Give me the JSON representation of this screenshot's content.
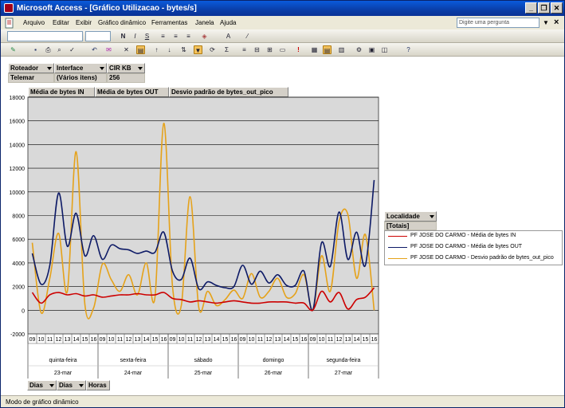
{
  "window": {
    "title": "Microsoft Access - [Gráfico Utilizacao - bytes/s]",
    "min": "_",
    "max": "❐",
    "close": "✕"
  },
  "menu": {
    "items": [
      "Arquivo",
      "Editar",
      "Exibir",
      "Gráfico dinâmico",
      "Ferramentas",
      "Janela",
      "Ajuda"
    ],
    "ask_placeholder": "Digite uma pergunta",
    "close": "×"
  },
  "filters": [
    {
      "field": "Roteador",
      "value": "Telemar"
    },
    {
      "field": "Interface",
      "value": "(Vários itens)"
    },
    {
      "field": "CIR KB",
      "value": "256"
    }
  ],
  "data_fields": [
    "Média de bytes IN",
    "Média de bytes OUT",
    "Desvio padrão de bytes_out_pico"
  ],
  "legend": {
    "title": "Localidade",
    "totals": "[Totais]",
    "entries": [
      "PF JOSE DO CARMO - Média de bytes IN",
      "PF JOSE DO CARMO - Média de bytes OUT",
      "PF JOSE DO CARMO - Desvio padrão de bytes_out_pico"
    ]
  },
  "axis_buttons": [
    "Dias",
    "Dias",
    "Horas"
  ],
  "status": "Modo de gráfico dinâmico",
  "chart_data": {
    "type": "line",
    "ylim": [
      -2000,
      18000
    ],
    "yticks": [
      18000,
      16000,
      14000,
      12000,
      10000,
      8000,
      6000,
      4000,
      2000,
      0,
      -2000
    ],
    "hours": [
      "09",
      "10",
      "11",
      "12",
      "13",
      "14",
      "15",
      "16"
    ],
    "days": [
      {
        "weekday": "quinta-feira",
        "date": "23-mar"
      },
      {
        "weekday": "sexta-feira",
        "date": "24-mar"
      },
      {
        "weekday": "sábado",
        "date": "25-mar"
      },
      {
        "weekday": "domingo",
        "date": "26-mar"
      },
      {
        "weekday": "segunda-feira",
        "date": "27-mar"
      }
    ],
    "series": [
      {
        "name": "PF JOSE DO CARMO - Média de bytes IN",
        "color": "#cc0000",
        "values": [
          1500,
          600,
          1300,
          1500,
          1300,
          1400,
          1200,
          1300,
          1100,
          1200,
          1300,
          1300,
          1400,
          1300,
          1300,
          1500,
          1000,
          900,
          700,
          800,
          700,
          600,
          700,
          800,
          700,
          600,
          600,
          700,
          700,
          700,
          600,
          600,
          0,
          1600,
          700,
          1500,
          100,
          900,
          1100,
          1900
        ]
      },
      {
        "name": "PF JOSE DO CARMO - Média de bytes OUT",
        "color": "#0d1a66",
        "values": [
          4800,
          2200,
          3800,
          9900,
          5400,
          8200,
          4600,
          6300,
          4300,
          5500,
          5200,
          5100,
          4800,
          5000,
          4900,
          6600,
          3300,
          2600,
          4400,
          1800,
          2400,
          2100,
          1900,
          2000,
          3800,
          2200,
          3300,
          2300,
          3000,
          2100,
          2100,
          3300,
          0,
          5700,
          3700,
          8300,
          4300,
          6600,
          3800,
          11000
        ]
      },
      {
        "name": "PF JOSE DO CARMO - Desvio padrão de bytes_out_pico",
        "color": "#e5a21a",
        "values": [
          5700,
          -200,
          2700,
          6500,
          1600,
          13400,
          500,
          200,
          3900,
          2600,
          1600,
          3000,
          1300,
          4000,
          1100,
          15800,
          2000,
          400,
          9600,
          200,
          1600,
          400,
          900,
          1700,
          1000,
          3100,
          1100,
          1600,
          2700,
          1100,
          1400,
          3000,
          0,
          4600,
          1600,
          7500,
          8100,
          2700,
          6400,
          0
        ]
      }
    ]
  }
}
